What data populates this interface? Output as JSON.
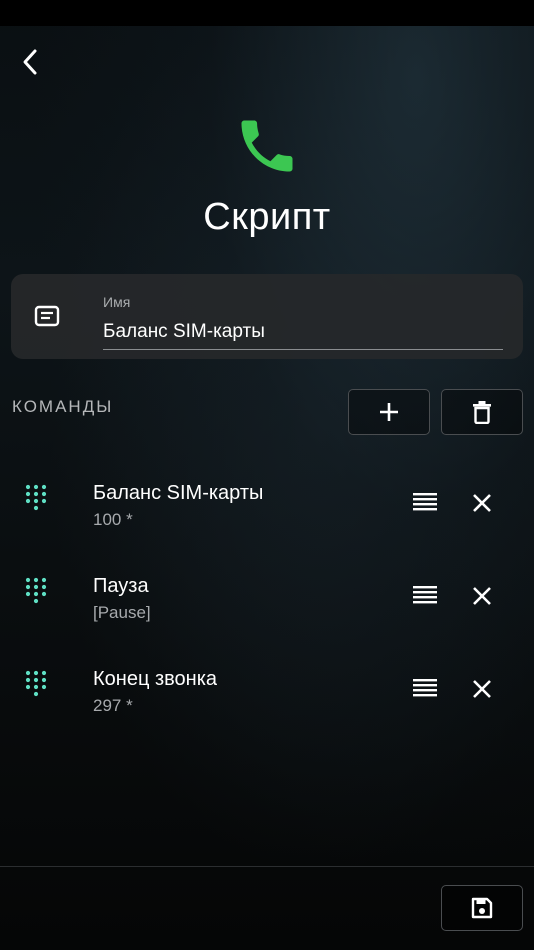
{
  "header": {
    "back_icon": "chevron-left-icon",
    "hero_icon": "phone-icon",
    "title": "Скрипт"
  },
  "name_field": {
    "icon": "document-icon",
    "label": "Имя",
    "value": "Баланс SIM-карты"
  },
  "commands_section": {
    "label": "КОМАНДЫ",
    "add_icon": "plus-icon",
    "delete_icon": "trash-icon"
  },
  "commands": [
    {
      "title": "Баланс SIM-карты",
      "detail": "100 *"
    },
    {
      "title": "Пауза",
      "detail": "[Pause]"
    },
    {
      "title": "Конец звонка",
      "detail": "297 *"
    }
  ],
  "footer": {
    "save_icon": "save-icon"
  },
  "colors": {
    "accent_green": "#3cc752",
    "dial_teal": "#5fe0c4",
    "card_bg": "#26282a"
  }
}
